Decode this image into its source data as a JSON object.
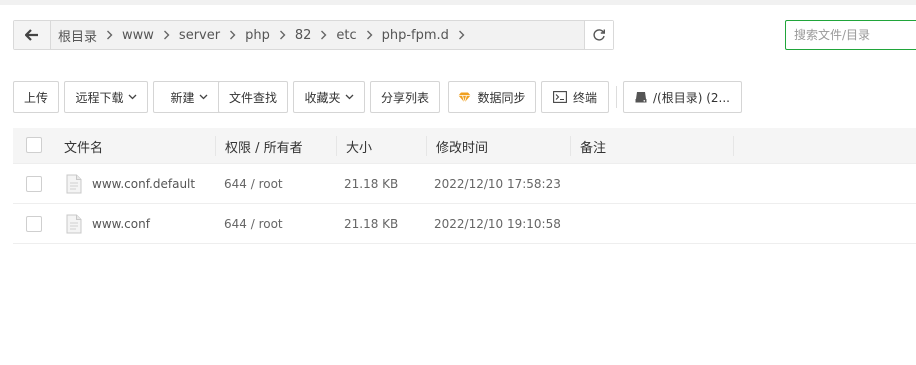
{
  "path": {
    "crumbs": [
      "根目录",
      "www",
      "server",
      "php",
      "82",
      "etc",
      "php-fpm.d"
    ]
  },
  "search": {
    "placeholder": "搜索文件/目录"
  },
  "toolbar": {
    "upload": "上传",
    "remote_download": "远程下载",
    "new": "新建",
    "file_search": "文件查找",
    "favorites": "收藏夹",
    "share_list": "分享列表",
    "data_sync": "数据同步",
    "terminal": "终端",
    "disk": "/(根目录) (2..."
  },
  "table": {
    "headers": {
      "name": "文件名",
      "perm": "权限 / 所有者",
      "size": "大小",
      "mtime": "修改时间",
      "note": "备注"
    },
    "rows": [
      {
        "name": "www.conf.default",
        "perm": "644 / root",
        "size": "21.18 KB",
        "mtime": "2022/12/10 17:58:23",
        "note": ""
      },
      {
        "name": "www.conf",
        "perm": "644 / root",
        "size": "21.18 KB",
        "mtime": "2022/12/10 19:10:58",
        "note": ""
      }
    ]
  },
  "colors": {
    "accent": "#20a53a",
    "sync_icon": "#f0a020"
  }
}
